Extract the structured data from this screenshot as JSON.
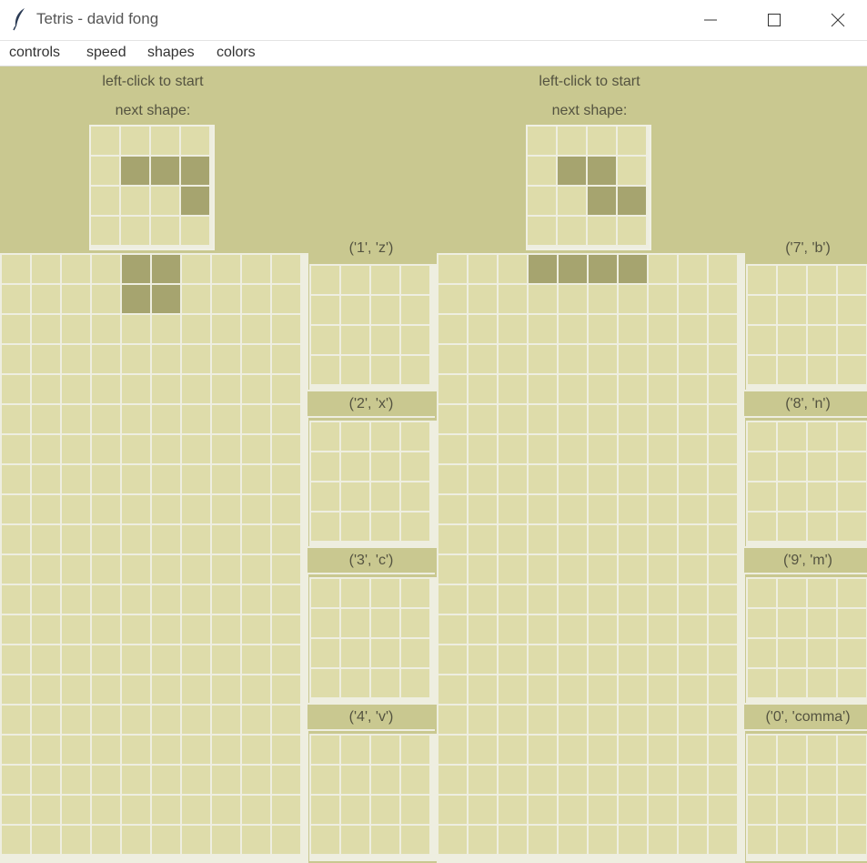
{
  "window": {
    "title": "Tetris - david fong",
    "app_icon": "feather-icon",
    "minimize_icon": "minimize-icon",
    "maximize_icon": "maximize-icon",
    "close_icon": "close-icon"
  },
  "menu": {
    "items": [
      "controls",
      "speed",
      "shapes",
      "colors"
    ]
  },
  "colors": {
    "background": "#c9c890",
    "cell_empty": "#dedcaa",
    "cell_filled": "#a6a46f",
    "grid_line": "#eeeee0"
  },
  "players": [
    {
      "status": "left-click to start",
      "next_label": "next shape:",
      "next_shape": [
        [
          0,
          0,
          0,
          0
        ],
        [
          0,
          1,
          1,
          1
        ],
        [
          0,
          0,
          0,
          1
        ],
        [
          0,
          0,
          0,
          0
        ]
      ],
      "board": {
        "cols": 10,
        "filled": [
          [
            4,
            0
          ],
          [
            5,
            0
          ],
          [
            4,
            1
          ],
          [
            5,
            1
          ]
        ]
      },
      "keys": [
        "('1', 'z')",
        "('2', 'x')",
        "('3', 'c')",
        "('4', 'v')"
      ]
    },
    {
      "status": "left-click to start",
      "next_label": "next shape:",
      "next_shape": [
        [
          0,
          0,
          0,
          0
        ],
        [
          0,
          1,
          1,
          0
        ],
        [
          0,
          0,
          1,
          1
        ],
        [
          0,
          0,
          0,
          0
        ]
      ],
      "board": {
        "cols": 10,
        "filled": [
          [
            3,
            0
          ],
          [
            4,
            0
          ],
          [
            5,
            0
          ],
          [
            6,
            0
          ]
        ]
      },
      "keys": [
        "('7', 'b')",
        "('8', 'n')",
        "('9', 'm')",
        "('0', 'comma')"
      ]
    }
  ]
}
